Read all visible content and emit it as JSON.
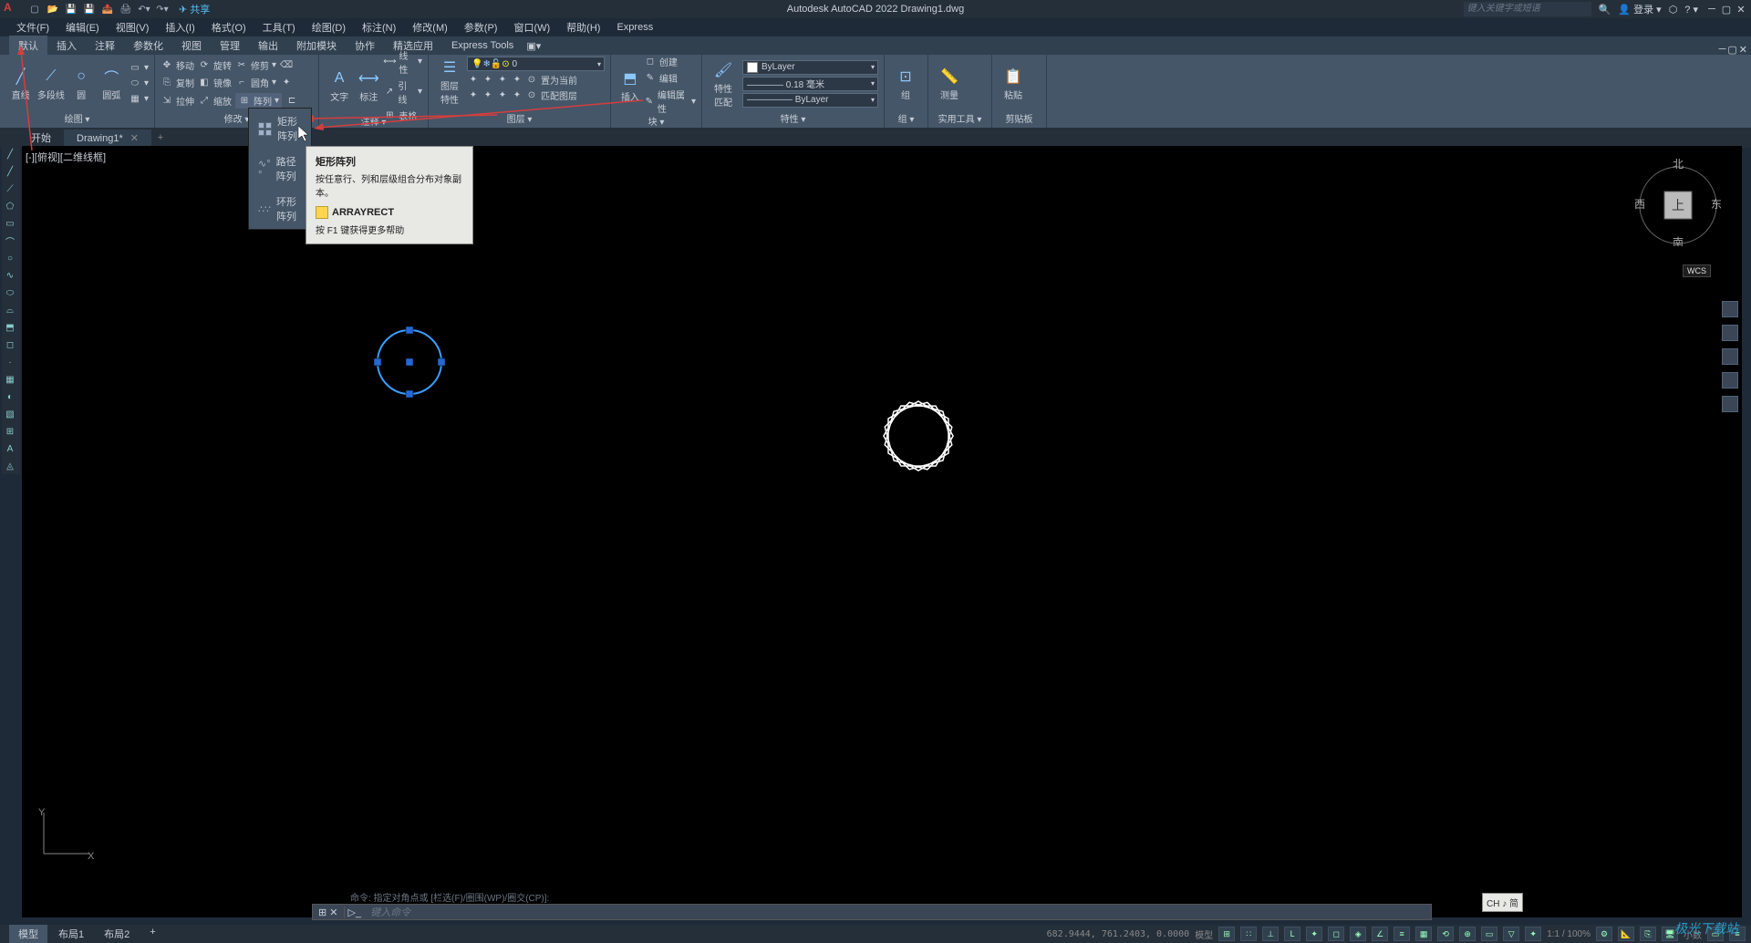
{
  "title": "Autodesk AutoCAD 2022    Drawing1.dwg",
  "share": "共享",
  "search_placeholder": "键入关键字或短语",
  "login": "登录",
  "menu": [
    "文件(F)",
    "编辑(E)",
    "视图(V)",
    "插入(I)",
    "格式(O)",
    "工具(T)",
    "绘图(D)",
    "标注(N)",
    "修改(M)",
    "参数(P)",
    "窗口(W)",
    "帮助(H)",
    "Express"
  ],
  "tabs": [
    "默认",
    "插入",
    "注释",
    "参数化",
    "视图",
    "管理",
    "输出",
    "附加模块",
    "协作",
    "精选应用",
    "Express Tools"
  ],
  "draw": {
    "line": "直线",
    "polyline": "多段线",
    "circle": "圆",
    "arc": "圆弧",
    "title": "绘图 ▾"
  },
  "modify": {
    "move": "移动",
    "rotate": "旋转",
    "trim": "修剪",
    "copy": "复制",
    "mirror": "镜像",
    "fillet": "圆角",
    "stretch": "拉伸",
    "scale": "缩放",
    "array": "阵列",
    "title": "修改 ▾"
  },
  "annot": {
    "text": "文字",
    "dim": "标注",
    "leader": "引线",
    "table": "表格",
    "linear": "线性",
    "title": "注释 ▾"
  },
  "layer": {
    "props": "图层\n特性",
    "setcurrent": "置为当前",
    "match": "匹配图层",
    "title": "图层 ▾",
    "zero": "0"
  },
  "block": {
    "insert": "插入",
    "create": "创建",
    "edit": "编辑",
    "attr": "编辑属性",
    "title": "块 ▾"
  },
  "props": {
    "match": "特性\n匹配",
    "bylayer1": "ByLayer",
    "linewt": "———— 0.18 毫米",
    "bylayer2": "————— ByLayer",
    "title": "特性 ▾"
  },
  "group": {
    "group": "组",
    "title": "组 ▾"
  },
  "util": {
    "measure": "测量",
    "title": "实用工具 ▾"
  },
  "clip": {
    "paste": "粘贴",
    "title": "剪贴板"
  },
  "array_menu": {
    "rect": "矩形阵列",
    "path": "路径阵列",
    "polar": "环形阵列"
  },
  "tooltip": {
    "title": "矩形阵列",
    "desc": "按任意行、列和层级组合分布对象副本。",
    "cmd": "ARRAYRECT",
    "help": "按 F1 键获得更多帮助"
  },
  "filetabs": {
    "start": "开始",
    "drawing": "Drawing1*"
  },
  "viewlabel": "[-][俯视][二维线框]",
  "viewcube": {
    "n": "北",
    "s": "南",
    "e": "东",
    "w": "西",
    "top": "上",
    "wcs": "WCS"
  },
  "cmd_hist": "命令: 指定对角点或 [栏选(F)/圈围(WP)/圈交(CP)]:",
  "cmd_prompt": "键入命令",
  "ime": "CH ♪ 简",
  "status": {
    "model": "模型",
    "layout1": "布局1",
    "layout2": "布局2",
    "coords": "682.9444, 761.2403, 0.0000",
    "mode": "模型",
    "scale": "1:1 / 100%",
    "dec": "小数"
  },
  "watermark": "极光下载站"
}
